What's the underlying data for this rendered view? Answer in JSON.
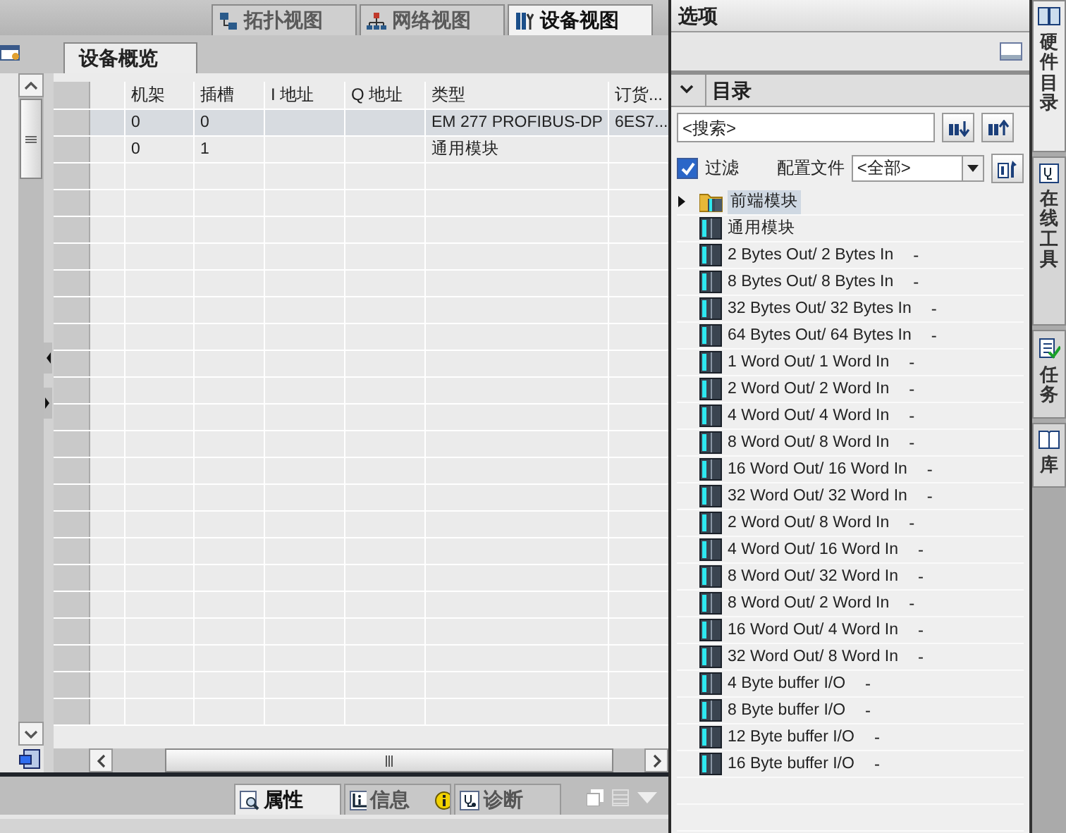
{
  "view_tabs": [
    {
      "label": "拓扑视图",
      "kind": "topology",
      "selected": false
    },
    {
      "label": "网络视图",
      "kind": "network",
      "selected": false
    },
    {
      "label": "设备视图",
      "kind": "device",
      "selected": true
    }
  ],
  "overview_tab": {
    "label": "设备概览"
  },
  "table": {
    "columns": [
      "机架",
      "插槽",
      "I 地址",
      "Q 地址",
      "类型",
      "订货..."
    ],
    "rows": [
      {
        "rack": "0",
        "slot": "0",
        "type": "EM 277 PROFIBUS-DP",
        "order_no": "6ES7...",
        "selected": true
      },
      {
        "rack": "0",
        "slot": "1",
        "type": "通用模块",
        "selected": false
      }
    ]
  },
  "bottom_tabs": [
    {
      "label": "属性",
      "kind": "properties",
      "selected": true
    },
    {
      "label": "信息",
      "kind": "info",
      "selected": false
    },
    {
      "label": "诊断",
      "kind": "diagnostics",
      "selected": false
    }
  ],
  "options_panel": {
    "title": "选项",
    "catalog": {
      "title": "目录",
      "expanded": true,
      "search": {
        "placeholder": "<搜索>"
      },
      "filter": {
        "label": "过滤",
        "checked": true
      },
      "profile": {
        "label": "配置文件",
        "value": "<全部>"
      },
      "tree": [
        {
          "label": "前端模块",
          "kind": "folder",
          "expanded": false,
          "selected": true
        },
        {
          "label": "通用模块",
          "kind": "module",
          "selected": false
        },
        {
          "label": "2 Bytes Out/ 2 Bytes In",
          "column_2": "-",
          "kind": "module",
          "selected": false
        },
        {
          "label": "8 Bytes Out/ 8 Bytes In",
          "column_2": "-",
          "kind": "module",
          "selected": false
        },
        {
          "label": "32 Bytes Out/ 32 Bytes In",
          "column_2": "-",
          "kind": "module",
          "selected": false
        },
        {
          "label": "64 Bytes Out/ 64 Bytes In",
          "column_2": "-",
          "kind": "module",
          "selected": false
        },
        {
          "label": "1 Word Out/ 1 Word In",
          "column_2": "-",
          "kind": "module",
          "selected": false
        },
        {
          "label": "2 Word Out/ 2 Word In",
          "column_2": "-",
          "kind": "module",
          "selected": false
        },
        {
          "label": "4 Word Out/ 4 Word In",
          "column_2": "-",
          "kind": "module",
          "selected": false
        },
        {
          "label": "8 Word Out/ 8 Word In",
          "column_2": "-",
          "kind": "module",
          "selected": false
        },
        {
          "label": "16 Word Out/ 16 Word In",
          "column_2": "-",
          "kind": "module",
          "selected": false
        },
        {
          "label": "32 Word Out/ 32 Word In",
          "column_2": "-",
          "kind": "module",
          "selected": false
        },
        {
          "label": "2 Word Out/ 8 Word In",
          "column_2": "-",
          "kind": "module",
          "selected": false
        },
        {
          "label": "4 Word Out/ 16 Word In",
          "column_2": "-",
          "kind": "module",
          "selected": false
        },
        {
          "label": "8 Word Out/ 32 Word In",
          "column_2": "-",
          "kind": "module",
          "selected": false
        },
        {
          "label": "8 Word Out/ 2 Word In",
          "column_2": "-",
          "kind": "module",
          "selected": false
        },
        {
          "label": "16 Word Out/ 4 Word In",
          "column_2": "-",
          "kind": "module",
          "selected": false
        },
        {
          "label": "32 Word Out/ 8 Word In",
          "column_2": "-",
          "kind": "module",
          "selected": false
        },
        {
          "label": "4 Byte buffer I/O",
          "column_2": "-",
          "kind": "module",
          "selected": false
        },
        {
          "label": "8 Byte buffer I/O",
          "column_2": "-",
          "kind": "module",
          "selected": false
        },
        {
          "label": "12 Byte buffer I/O",
          "column_2": "-",
          "kind": "module",
          "selected": false
        },
        {
          "label": "16 Byte buffer I/O",
          "column_2": "-",
          "kind": "module",
          "selected": false
        }
      ]
    }
  },
  "side_tabs": [
    {
      "label": "硬件目录",
      "kind": "catalog",
      "selected": true
    },
    {
      "label": "在线工具",
      "kind": "online",
      "selected": false
    },
    {
      "label": "任务",
      "kind": "tasks",
      "selected": false
    },
    {
      "label": "库",
      "kind": "library",
      "selected": false
    }
  ]
}
